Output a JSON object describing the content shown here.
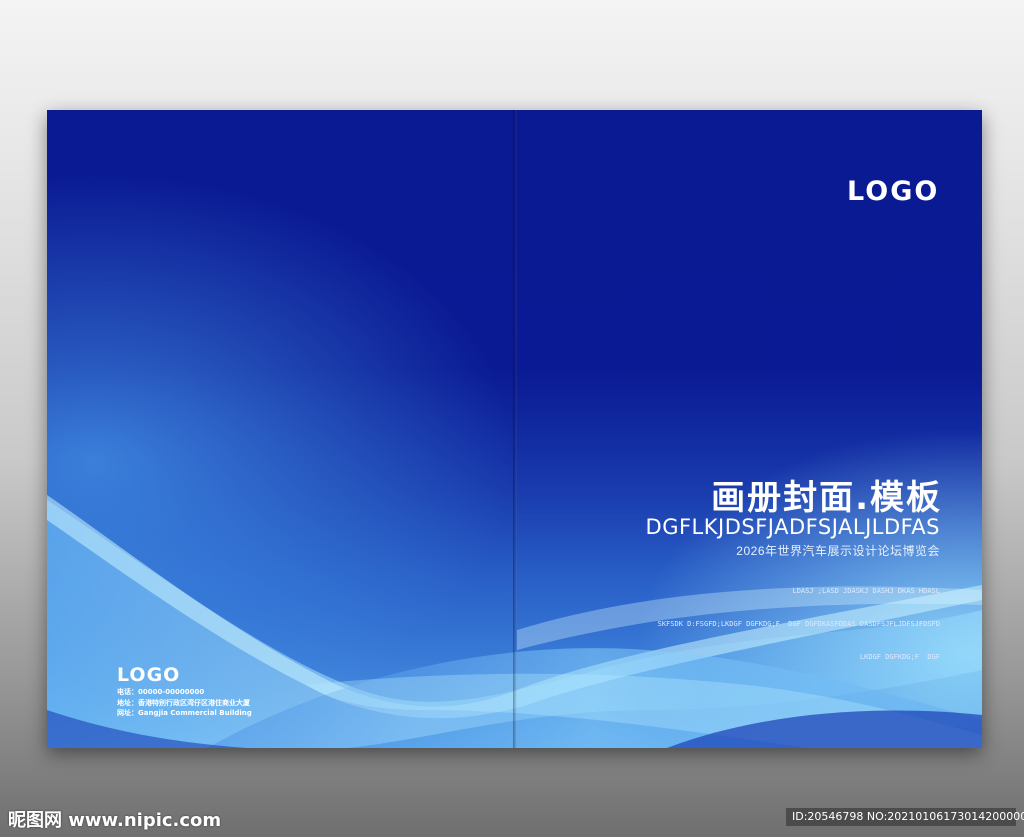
{
  "colors": {
    "cover_blue": "#0a1890",
    "wave_light": "#a8e6ff",
    "text": "#ffffff"
  },
  "front_cover": {
    "logo": "LOGO",
    "title": "画册封面.模板",
    "subtitle": "DGFLKJDSFJADFSJALJLDFAS",
    "chinese_line": "2026年世界汽车展示设计论坛博览会",
    "small_text": [
      "LDASJ ;LASD JDASKJ DASHJ DKAS HDASL",
      "SKFSDK D:FSGFD;LKDGF DGFKDG;F  DGF DGFDKASFDDAS DASDFSJFLJDFSJFDSFD",
      "LKDGF DGFKDG;F  DGF"
    ]
  },
  "back_cover": {
    "logo": "LOGO",
    "phone": "电话：00000-00000000",
    "address": "地址：香港特别行政区湾仔区港住商业大厦",
    "website": "网址：Gangjia Commercial Building"
  },
  "watermark": {
    "site": "昵图网 www.nipic.com",
    "id_info": "ID:20546798 NO:20210106173014200000"
  }
}
